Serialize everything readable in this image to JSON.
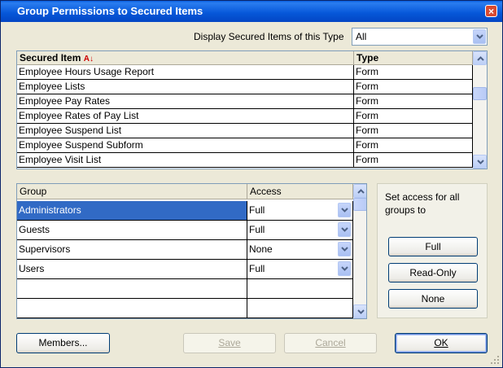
{
  "window": {
    "title": "Group Permissions to Secured Items",
    "close_symbol": "×"
  },
  "filter": {
    "label": "Display Secured Items of this Type",
    "value": "All"
  },
  "items_table": {
    "columns": [
      "Secured Item",
      "Type"
    ],
    "sort_indicator": "A↓",
    "rows": [
      {
        "name": "Employee Hours Usage Report",
        "type": "Form"
      },
      {
        "name": "Employee Lists",
        "type": "Form"
      },
      {
        "name": "Employee Pay Rates",
        "type": "Form"
      },
      {
        "name": "Employee Rates of Pay List",
        "type": "Form"
      },
      {
        "name": "Employee Suspend List",
        "type": "Form"
      },
      {
        "name": "Employee Suspend Subform",
        "type": "Form"
      },
      {
        "name": "Employee Visit List",
        "type": "Form"
      }
    ]
  },
  "groups_table": {
    "columns": [
      "Group",
      "Access"
    ],
    "rows": [
      {
        "group": "Administrators",
        "access": "Full",
        "selected": true
      },
      {
        "group": "Guests",
        "access": "Full",
        "selected": false
      },
      {
        "group": "Supervisors",
        "access": "None",
        "selected": false
      },
      {
        "group": "Users",
        "access": "Full",
        "selected": false
      }
    ],
    "selection_color": "#316ac5"
  },
  "set_access": {
    "caption": "Set access for all groups to",
    "buttons": [
      "Full",
      "Read-Only",
      "None"
    ]
  },
  "footer": {
    "members": "Members...",
    "save": "Save",
    "cancel": "Cancel",
    "ok": "OK"
  }
}
